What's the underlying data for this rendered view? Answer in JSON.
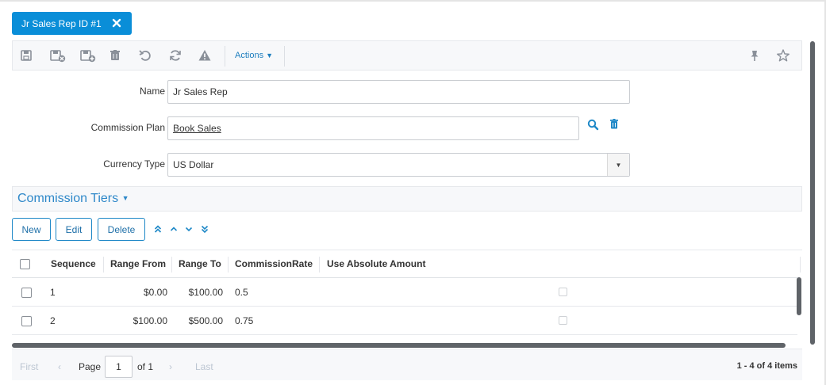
{
  "tab": {
    "title": "Jr Sales Rep ID #1"
  },
  "toolbar": {
    "icons": [
      "save-icon",
      "save-and-new-icon",
      "save-and-add-icon",
      "trash-icon",
      "undo-icon",
      "refresh-icon",
      "warning-icon",
      "pin-icon",
      "star-icon"
    ],
    "actions_label": "Actions"
  },
  "form": {
    "name": {
      "label": "Name",
      "value": "Jr Sales Rep"
    },
    "commission_plan": {
      "label": "Commission Plan",
      "value": "Book Sales"
    },
    "currency_type": {
      "label": "Currency Type",
      "value": "US Dollar"
    }
  },
  "section": {
    "title": "Commission Tiers"
  },
  "buttons": {
    "new": "New",
    "edit": "Edit",
    "delete": "Delete"
  },
  "grid": {
    "columns": [
      "Sequence",
      "Range From",
      "Range To",
      "CommissionRate",
      "Use Absolute Amount"
    ],
    "rows": [
      {
        "sequence": "1",
        "range_from": "$0.00",
        "range_to": "$100.00",
        "rate": "0.5",
        "use_absolute": false
      },
      {
        "sequence": "2",
        "range_from": "$100.00",
        "range_to": "$500.00",
        "rate": "0.75",
        "use_absolute": false
      }
    ]
  },
  "pager": {
    "first": "First",
    "page_label": "Page",
    "page": "1",
    "of": "of 1",
    "last": "Last",
    "summary": "1 - 4 of 4 items"
  },
  "colors": {
    "accent": "#0a8ed8",
    "link": "#1e88c7",
    "section_title": "#2e88c9"
  }
}
